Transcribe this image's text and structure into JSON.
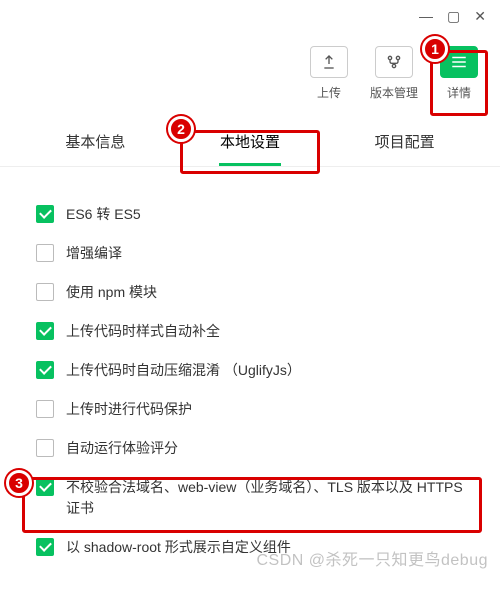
{
  "window_controls": {
    "minimize": "—",
    "maximize": "▢",
    "close": "✕"
  },
  "toolbar": {
    "upload": {
      "label": "上传"
    },
    "version": {
      "label": "版本管理"
    },
    "details": {
      "label": "详情"
    }
  },
  "tabs": {
    "basic": "基本信息",
    "local": "本地设置",
    "project": "项目配置",
    "active": "local"
  },
  "settings": [
    {
      "key": "es6",
      "checked": true,
      "label": "ES6 转 ES5"
    },
    {
      "key": "enhance",
      "checked": false,
      "label": "增强编译"
    },
    {
      "key": "npm",
      "checked": false,
      "label": "使用 npm 模块"
    },
    {
      "key": "style",
      "checked": true,
      "label": "上传代码时样式自动补全"
    },
    {
      "key": "uglify",
      "checked": true,
      "label": "上传代码时自动压缩混淆 （UglifyJs）"
    },
    {
      "key": "protect",
      "checked": false,
      "label": "上传时进行代码保护"
    },
    {
      "key": "audit",
      "checked": false,
      "label": "自动运行体验评分"
    },
    {
      "key": "nocheck",
      "checked": true,
      "label": "不校验合法域名、web-view（业务域名）、TLS 版本以及 HTTPS 证书"
    },
    {
      "key": "shadowroot",
      "checked": true,
      "label": "以 shadow-root 形式展示自定义组件"
    }
  ],
  "annotations": {
    "a1": "1",
    "a2": "2",
    "a3": "3"
  },
  "watermark": "CSDN @杀死一只知更鸟debug"
}
